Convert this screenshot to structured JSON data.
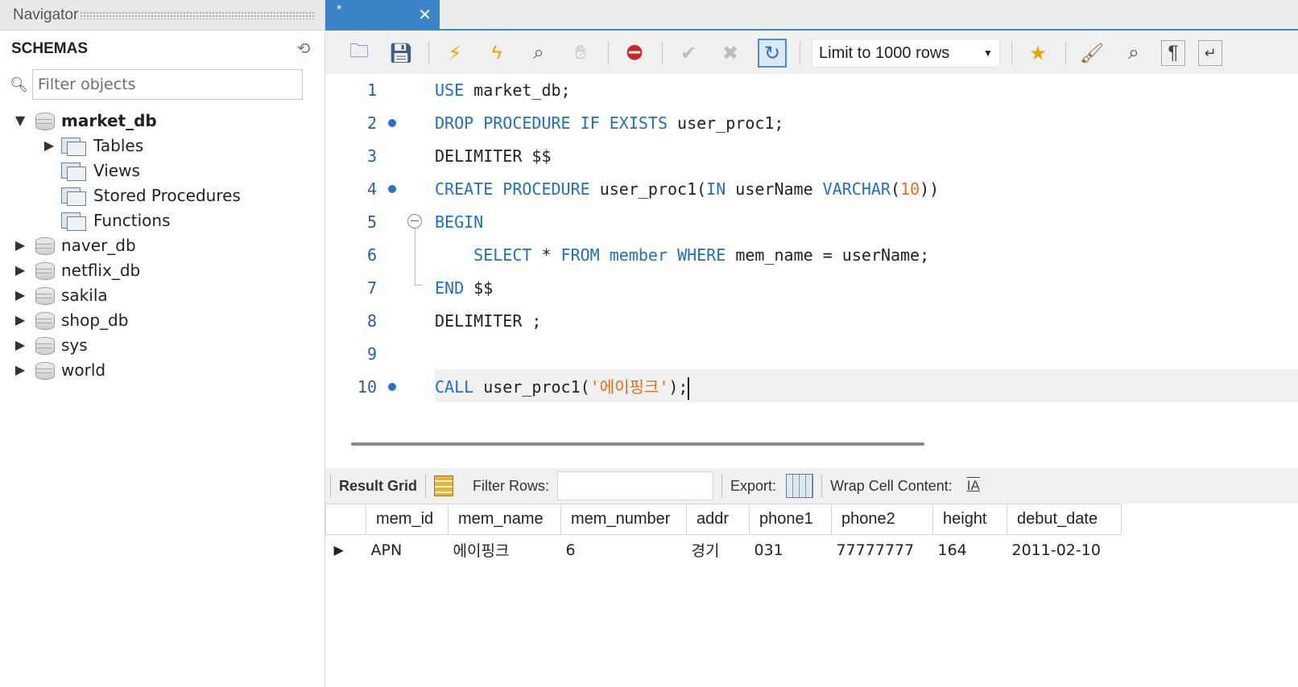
{
  "navigator": {
    "title": "Navigator",
    "schemas_label": "SCHEMAS",
    "filter_placeholder": "Filter objects",
    "expanded_db": "market_db",
    "market_children": [
      "Tables",
      "Views",
      "Stored Procedures",
      "Functions"
    ],
    "other_dbs": [
      "naver_db",
      "netflix_db",
      "sakila",
      "shop_db",
      "sys",
      "world"
    ]
  },
  "editor": {
    "tab_title": "*",
    "tab_close": "✕",
    "toolbar": {
      "limit_label": "Limit to 1000 rows",
      "icons": [
        "open-file-icon",
        "save-icon",
        "execute-icon",
        "execute-current-icon",
        "explain-icon",
        "stop-icon",
        "toggle-error-icon",
        "commit-icon",
        "rollback-icon",
        "autocommit-icon",
        "add-snippet-icon",
        "beautify-icon",
        "find-icon",
        "invisible-chars-icon",
        "wrap-lines-icon"
      ]
    },
    "lines": [
      {
        "n": "1",
        "bp": false
      },
      {
        "n": "2",
        "bp": true
      },
      {
        "n": "3",
        "bp": false
      },
      {
        "n": "4",
        "bp": true
      },
      {
        "n": "5",
        "bp": false
      },
      {
        "n": "6",
        "bp": false
      },
      {
        "n": "7",
        "bp": false
      },
      {
        "n": "8",
        "bp": false
      },
      {
        "n": "9",
        "bp": false
      },
      {
        "n": "10",
        "bp": true
      }
    ],
    "code": {
      "l1_kw": "USE",
      "l1_rest": " market_db;",
      "l2_kw": "DROP PROCEDURE IF EXISTS",
      "l2_rest": " user_proc1;",
      "l3": "DELIMITER $$",
      "l4_kw1": "CREATE PROCEDURE",
      "l4_mid": " user_proc1(",
      "l4_kw2": "IN",
      "l4_mid2": " userName ",
      "l4_kw3": "VARCHAR",
      "l4_open": "(",
      "l4_num": "10",
      "l4_close": "))",
      "l5_kw": "BEGIN",
      "l6_indent": "    ",
      "l6_kw1": "SELECT",
      "l6_mid1": " * ",
      "l6_kw2": "FROM",
      "l6_mid2": " ",
      "l6_tbl": "member",
      "l6_mid3": " ",
      "l6_kw3": "WHERE",
      "l6_rest": " mem_name = userName;",
      "l7_kw": "END",
      "l7_rest": " $$",
      "l8": "DELIMITER ;",
      "l10_kw": "CALL",
      "l10_mid": " user_proc1(",
      "l10_str": "'에이핑크'",
      "l10_end": ");"
    }
  },
  "result": {
    "result_grid_label": "Result Grid",
    "filter_rows_label": "Filter Rows:",
    "export_label": "Export:",
    "wrap_label": "Wrap Cell Content:",
    "wrap_icon": "IA",
    "columns": [
      "mem_id",
      "mem_name",
      "mem_number",
      "addr",
      "phone1",
      "phone2",
      "height",
      "debut_date"
    ],
    "rows": [
      [
        "APN",
        "에이핑크",
        "6",
        "경기",
        "031",
        "77777777",
        "164",
        "2011-02-10"
      ]
    ]
  },
  "colors": {
    "accent": "#3b84c7",
    "keyword": "#1f6fc9",
    "string": "#e07020"
  }
}
